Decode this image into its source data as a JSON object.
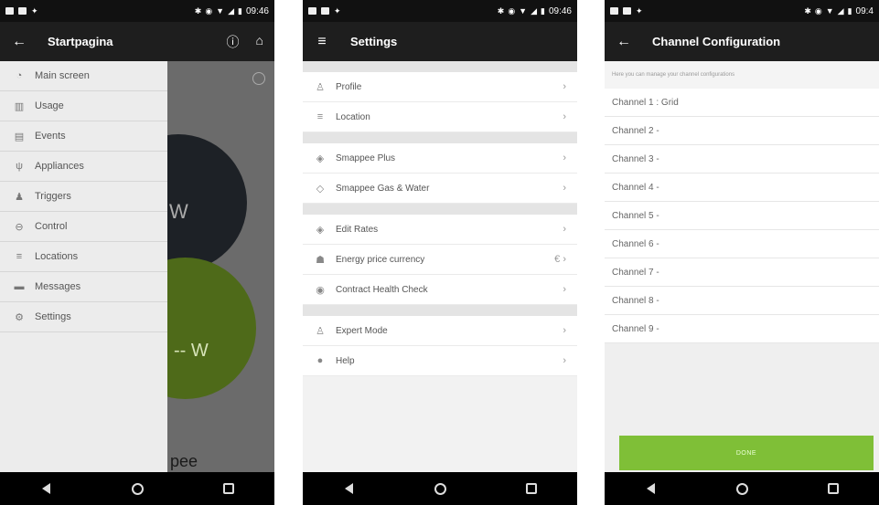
{
  "screens": [
    {
      "status": {
        "time": "09:46"
      },
      "appbar": {
        "title": "Startpagina"
      },
      "drawer": {
        "items": [
          {
            "label": "Main screen",
            "icon": "pulse-icon"
          },
          {
            "label": "Usage",
            "icon": "bar-chart-icon"
          },
          {
            "label": "Events",
            "icon": "calendar-icon"
          },
          {
            "label": "Appliances",
            "icon": "plug-icon"
          },
          {
            "label": "Triggers",
            "icon": "trigger-icon"
          },
          {
            "label": "Control",
            "icon": "control-icon"
          },
          {
            "label": "Locations",
            "icon": "location-icon"
          },
          {
            "label": "Messages",
            "icon": "message-icon"
          },
          {
            "label": "Settings",
            "icon": "gear-icon"
          }
        ]
      },
      "background": {
        "dark_value": "W",
        "green_value": "-- W",
        "logo_fragment": "pee"
      }
    },
    {
      "status": {
        "time": "09:46"
      },
      "appbar": {
        "title": "Settings"
      },
      "groups": [
        [
          {
            "label": "Profile",
            "icon": "person-icon"
          },
          {
            "label": "Location",
            "icon": "location-icon"
          }
        ],
        [
          {
            "label": "Smappee Plus",
            "icon": "plus-icon"
          },
          {
            "label": "Smappee Gas & Water",
            "icon": "drop-icon"
          }
        ],
        [
          {
            "label": "Edit Rates",
            "icon": "rates-icon"
          },
          {
            "label": "Energy price currency",
            "icon": "currency-icon",
            "extra": "€"
          },
          {
            "label": "Contract Health Check",
            "icon": "health-icon"
          }
        ],
        [
          {
            "label": "Expert Mode",
            "icon": "expert-icon"
          },
          {
            "label": "Help",
            "icon": "help-icon"
          }
        ]
      ]
    },
    {
      "status": {
        "time": "09:4"
      },
      "appbar": {
        "title": "Channel Configuration"
      },
      "note": "Here you can manage your channel configurations",
      "channels": [
        "Channel 1 : Grid",
        "Channel 2 -",
        "Channel 3 -",
        "Channel 4 -",
        "Channel 5 -",
        "Channel 6 -",
        "Channel 7 -",
        "Channel 8 -",
        "Channel 9 -"
      ],
      "done_label": "DONE"
    }
  ],
  "colors": {
    "accent_green": "#7fbf37",
    "dark_green": "#4e6a19",
    "appbar": "#1e1e1e"
  }
}
